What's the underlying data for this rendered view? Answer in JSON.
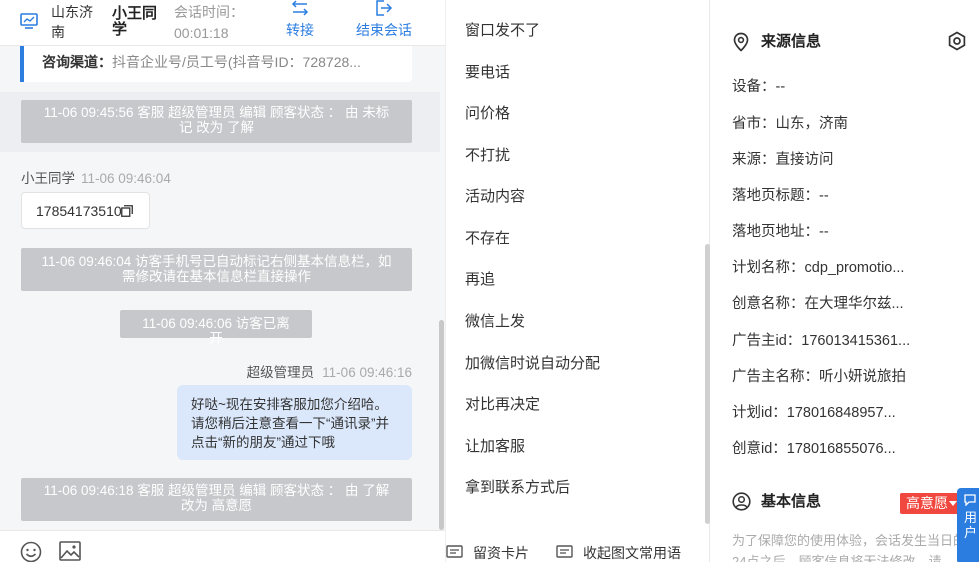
{
  "header": {
    "visitor_location": "山东济南",
    "visitor_name": "小王同学",
    "session_time_label": "会话时间：",
    "session_time_value": "00:01:18",
    "transfer_label": "转接",
    "end_label": "结束会话"
  },
  "channel": {
    "label": "咨询渠道：",
    "value": "抖音企业号/员工号(抖音号ID：728728..."
  },
  "messages": {
    "sys1": "11-06 09:45:56 客服 超级管理员 编辑 顾客状态 ： 由 未标记 改为 了解",
    "msg1_sender": "小王同学",
    "msg1_time": "11-06 09:46:04",
    "msg1_phone": "17854173510",
    "sys2": "11-06 09:46:04 访客手机号已自动标记右侧基本信息栏，如需修改请在基本信息栏直接操作",
    "sys3": "11-06 09:46:06 访客已离开",
    "msg2_sender": "超级管理员",
    "msg2_time": "11-06 09:46:16",
    "msg2_text": "好哒~现在安排客服加您介绍哈。请您稍后注意查看一下“通讯录”并点击“新的朋友”通过下哦",
    "sys4": "11-06 09:46:18 客服 超级管理员 编辑 顾客状态 ： 由 了解 改为 高意愿"
  },
  "quick_replies": [
    "窗口发不了",
    "要电话",
    "问价格",
    "不打扰",
    "活动内容",
    "不存在",
    "再追",
    "微信上发",
    "加微信时说自动分配",
    "对比再决定",
    "让加客服",
    "拿到联系方式后"
  ],
  "quick_footer": {
    "card_label": "留资卡片",
    "collapse_label": "收起图文常用语"
  },
  "info": {
    "source_title": "来源信息",
    "rows": [
      "设备：--",
      "省市：山东，济南",
      "来源：直接访问",
      "落地页标题：--",
      "落地页地址：--",
      "计划名称：cdp_promotio...",
      "创意名称：在大理华尔兹...",
      "广告主id：176013415361...",
      "广告主名称：听小妍说旅拍",
      "计划id：178016848957...",
      "创意id：178016855076..."
    ],
    "basic_title": "基本信息",
    "intent_tag": "高意愿",
    "basic_note": "为了保障您的使用体验，会话发生当日的24点之后，顾客信息将无法修改，请",
    "user_float": "用户"
  },
  "colors": {
    "accent": "#2b7de0",
    "system_bubble": "#c6c8cc",
    "reply_bubble": "#dbe8fb",
    "intent_tag": "#f0473e"
  }
}
